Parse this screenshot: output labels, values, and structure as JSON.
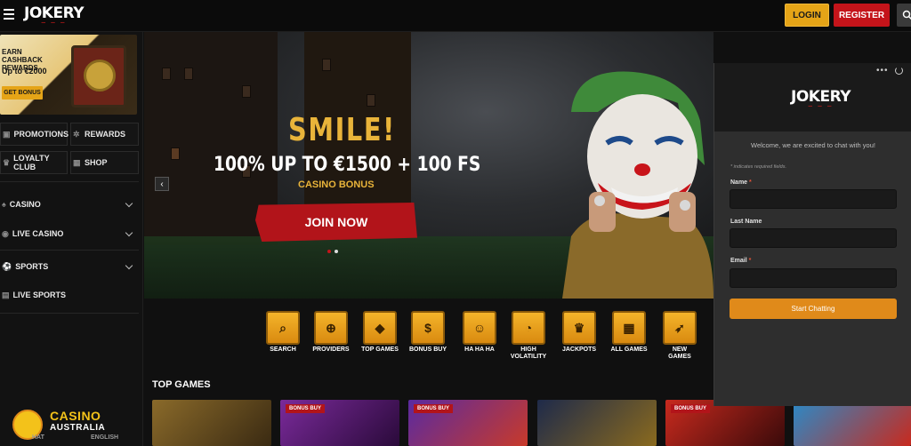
{
  "header": {
    "logo": "JOKERY",
    "login_label": "LOGIN",
    "register_label": "REGISTER",
    "colors": {
      "login": "#e5a417",
      "register": "#c4141a"
    },
    "icons": {
      "menu": "hamburger-icon",
      "search": "search-icon"
    }
  },
  "sidebar": {
    "promo": {
      "line1": "EARN CASHBACK",
      "line2": "REWARDS",
      "amount": "Up to €2000",
      "button": "GET BONUS"
    },
    "quick_buttons": [
      {
        "label": "PROMOTIONS",
        "icon": "gift-icon"
      },
      {
        "label": "REWARDS",
        "icon": "gear-icon"
      },
      {
        "label": "LOYALTY CLUB",
        "icon": "crown-icon"
      },
      {
        "label": "SHOP",
        "icon": "shop-icon"
      }
    ],
    "nav": [
      {
        "label": "CASINO",
        "icon": "cards-icon",
        "expandable": true
      },
      {
        "label": "LIVE CASINO",
        "icon": "live-icon",
        "expandable": true
      },
      {
        "label": "SPORTS",
        "icon": "ball-icon",
        "expandable": true
      },
      {
        "label": "LIVE SPORTS",
        "icon": "live-sports-icon",
        "expandable": false
      }
    ]
  },
  "hero": {
    "headline": "SMILE!",
    "offer": "100% UP TO €1500 + 100 FS",
    "subtitle": "CASINO BONUS",
    "cta": "JOIN NOW",
    "slides_total": 2,
    "slide_active": 1
  },
  "categories": [
    {
      "label": "SEARCH",
      "icon": "search-icon"
    },
    {
      "label": "PROVIDERS",
      "icon": "globe-icon"
    },
    {
      "label": "TOP GAMES",
      "icon": "diamond-icon"
    },
    {
      "label": "BONUS BUY",
      "icon": "moneybag-icon"
    },
    {
      "label": "HA HA HA",
      "icon": "grin-icon"
    },
    {
      "label": "HIGH VOLATILITY",
      "icon": "gauge-icon"
    },
    {
      "label": "JACKPOTS",
      "icon": "crown-icon"
    },
    {
      "label": "ALL GAMES",
      "icon": "slot-icon"
    },
    {
      "label": "NEW GAMES",
      "icon": "rocket-icon"
    }
  ],
  "top_games": {
    "title": "TOP GAMES",
    "badge_label": "BONUS BUY",
    "games": [
      {
        "badge": false,
        "color": "#6a4a1a"
      },
      {
        "badge": true,
        "color": "#5a1e6a"
      },
      {
        "badge": true,
        "color": "#3a1a6a"
      },
      {
        "badge": false,
        "color": "#1e2a4a"
      },
      {
        "badge": true,
        "color": "#8a2a1e"
      },
      {
        "badge": false,
        "color": "#1e5a8a"
      }
    ]
  },
  "chat": {
    "logo": "JOKERY",
    "welcome": "Welcome, we are excited to chat with you!",
    "required_note": "* indicates required fields.",
    "fields": [
      {
        "label": "Name",
        "required": true,
        "value": ""
      },
      {
        "label": "Last Name",
        "required": false,
        "value": ""
      },
      {
        "label": "Email",
        "required": true,
        "value": ""
      }
    ],
    "submit": "Start Chatting",
    "accent": "#e08a1a"
  },
  "watermark": {
    "line1": "CASINO",
    "line2": "AUSTRALIA",
    "under_left": "HAT",
    "under_right": "ENGLISH"
  }
}
